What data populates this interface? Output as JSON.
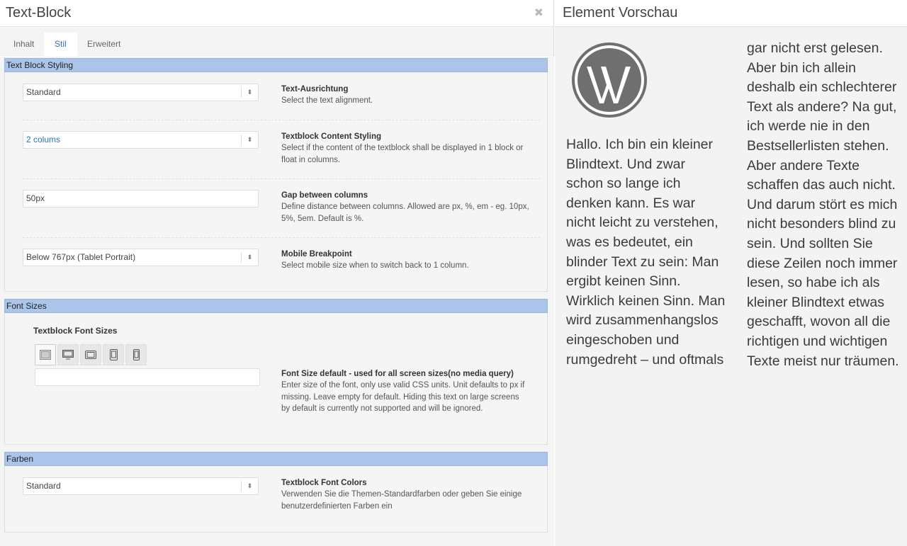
{
  "editor": {
    "title": "Text-Block",
    "close_icon": "close-icon",
    "tabs": [
      {
        "label": "Inhalt",
        "active": false
      },
      {
        "label": "Stil",
        "active": true
      },
      {
        "label": "Erweitert",
        "active": false
      }
    ]
  },
  "sections": {
    "styling": {
      "heading": "Text Block Styling",
      "alignment": {
        "value": "Standard",
        "label": "Text-Ausrichtung",
        "help": "Select the text alignment."
      },
      "content_styling": {
        "value": "2 colums",
        "label": "Textblock Content Styling",
        "help": "Select if the content of the textblock shall be displayed in 1 block or float in columns."
      },
      "gap": {
        "value": "50px",
        "label": "Gap between columns",
        "help": "Define distance between columns. Allowed are px, %, em - eg. 10px, 5%, 5em. Default is %."
      },
      "breakpoint": {
        "value": "Below 767px (Tablet Portrait)",
        "label": "Mobile Breakpoint",
        "help": "Select mobile size when to switch back to 1 column."
      }
    },
    "font_sizes": {
      "heading": "Font Sizes",
      "sub_label": "Textblock Font Sizes",
      "devices": [
        "default-size-icon",
        "desktop-icon",
        "tablet-landscape-icon",
        "tablet-portrait-icon",
        "mobile-icon"
      ],
      "value": "",
      "label": "Font Size default - used for all screen sizes(no media query)",
      "help": "Enter size of the font, only use valid CSS units. Unit defaults to px if missing. Leave empty for default. Hiding this text on large screens by default is currently not supported and will be ignored."
    },
    "colors": {
      "heading": "Farben",
      "value": "Standard",
      "label": "Textblock Font Colors",
      "help": "Verwenden Sie die Themen-Standardfarben oder geben Sie einige benutzerdefinierten Farben ein"
    }
  },
  "preview": {
    "title": "Element Vorschau",
    "logo": "wordpress-logo",
    "column1": "Hallo. Ich bin ein kleiner Blindtext. Und zwar schon so lange ich denken kann. Es war nicht leicht zu verstehen, was es bedeutet, ein blinder Text zu sein: Man ergibt keinen Sinn. Wirklich keinen Sinn. Man wird zusammenhangslos eingeschoben und rumgedreht – und oftmals",
    "column2": "gar nicht erst gelesen. Aber bin ich allein deshalb ein schlechterer Text als andere? Na gut, ich werde nie in den Bestsellerlisten stehen. Aber andere Texte schaffen das auch nicht. Und darum stört es mich nicht besonders blind zu sein. Und sollten Sie diese Zeilen noch immer lesen, so habe ich als kleiner Blindtext etwas geschafft, wovon all die richtigen und wichtigen Texte meist nur träumen."
  },
  "colors": {
    "section_header": "#aac4ea",
    "active_tab": "#2a72b5"
  }
}
